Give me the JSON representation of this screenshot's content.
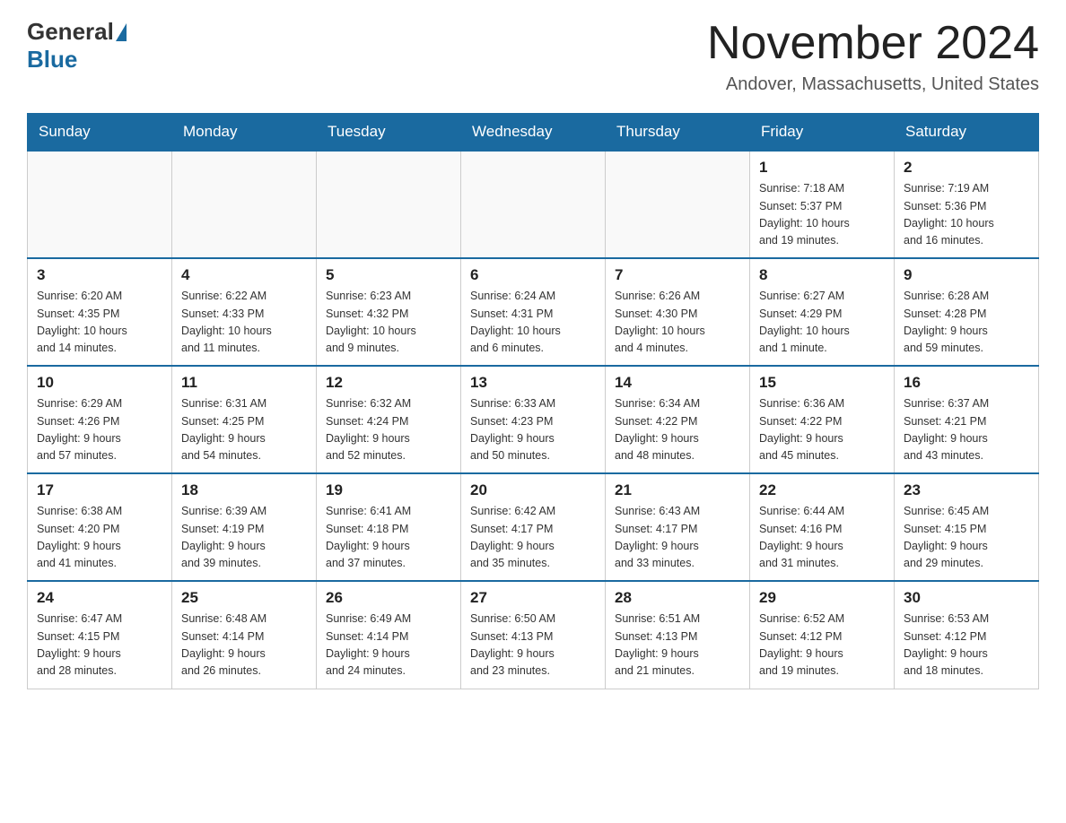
{
  "logo": {
    "general": "General",
    "blue": "Blue"
  },
  "title": "November 2024",
  "location": "Andover, Massachusetts, United States",
  "weekdays": [
    "Sunday",
    "Monday",
    "Tuesday",
    "Wednesday",
    "Thursday",
    "Friday",
    "Saturday"
  ],
  "weeks": [
    [
      {
        "day": "",
        "info": ""
      },
      {
        "day": "",
        "info": ""
      },
      {
        "day": "",
        "info": ""
      },
      {
        "day": "",
        "info": ""
      },
      {
        "day": "",
        "info": ""
      },
      {
        "day": "1",
        "info": "Sunrise: 7:18 AM\nSunset: 5:37 PM\nDaylight: 10 hours\nand 19 minutes."
      },
      {
        "day": "2",
        "info": "Sunrise: 7:19 AM\nSunset: 5:36 PM\nDaylight: 10 hours\nand 16 minutes."
      }
    ],
    [
      {
        "day": "3",
        "info": "Sunrise: 6:20 AM\nSunset: 4:35 PM\nDaylight: 10 hours\nand 14 minutes."
      },
      {
        "day": "4",
        "info": "Sunrise: 6:22 AM\nSunset: 4:33 PM\nDaylight: 10 hours\nand 11 minutes."
      },
      {
        "day": "5",
        "info": "Sunrise: 6:23 AM\nSunset: 4:32 PM\nDaylight: 10 hours\nand 9 minutes."
      },
      {
        "day": "6",
        "info": "Sunrise: 6:24 AM\nSunset: 4:31 PM\nDaylight: 10 hours\nand 6 minutes."
      },
      {
        "day": "7",
        "info": "Sunrise: 6:26 AM\nSunset: 4:30 PM\nDaylight: 10 hours\nand 4 minutes."
      },
      {
        "day": "8",
        "info": "Sunrise: 6:27 AM\nSunset: 4:29 PM\nDaylight: 10 hours\nand 1 minute."
      },
      {
        "day": "9",
        "info": "Sunrise: 6:28 AM\nSunset: 4:28 PM\nDaylight: 9 hours\nand 59 minutes."
      }
    ],
    [
      {
        "day": "10",
        "info": "Sunrise: 6:29 AM\nSunset: 4:26 PM\nDaylight: 9 hours\nand 57 minutes."
      },
      {
        "day": "11",
        "info": "Sunrise: 6:31 AM\nSunset: 4:25 PM\nDaylight: 9 hours\nand 54 minutes."
      },
      {
        "day": "12",
        "info": "Sunrise: 6:32 AM\nSunset: 4:24 PM\nDaylight: 9 hours\nand 52 minutes."
      },
      {
        "day": "13",
        "info": "Sunrise: 6:33 AM\nSunset: 4:23 PM\nDaylight: 9 hours\nand 50 minutes."
      },
      {
        "day": "14",
        "info": "Sunrise: 6:34 AM\nSunset: 4:22 PM\nDaylight: 9 hours\nand 48 minutes."
      },
      {
        "day": "15",
        "info": "Sunrise: 6:36 AM\nSunset: 4:22 PM\nDaylight: 9 hours\nand 45 minutes."
      },
      {
        "day": "16",
        "info": "Sunrise: 6:37 AM\nSunset: 4:21 PM\nDaylight: 9 hours\nand 43 minutes."
      }
    ],
    [
      {
        "day": "17",
        "info": "Sunrise: 6:38 AM\nSunset: 4:20 PM\nDaylight: 9 hours\nand 41 minutes."
      },
      {
        "day": "18",
        "info": "Sunrise: 6:39 AM\nSunset: 4:19 PM\nDaylight: 9 hours\nand 39 minutes."
      },
      {
        "day": "19",
        "info": "Sunrise: 6:41 AM\nSunset: 4:18 PM\nDaylight: 9 hours\nand 37 minutes."
      },
      {
        "day": "20",
        "info": "Sunrise: 6:42 AM\nSunset: 4:17 PM\nDaylight: 9 hours\nand 35 minutes."
      },
      {
        "day": "21",
        "info": "Sunrise: 6:43 AM\nSunset: 4:17 PM\nDaylight: 9 hours\nand 33 minutes."
      },
      {
        "day": "22",
        "info": "Sunrise: 6:44 AM\nSunset: 4:16 PM\nDaylight: 9 hours\nand 31 minutes."
      },
      {
        "day": "23",
        "info": "Sunrise: 6:45 AM\nSunset: 4:15 PM\nDaylight: 9 hours\nand 29 minutes."
      }
    ],
    [
      {
        "day": "24",
        "info": "Sunrise: 6:47 AM\nSunset: 4:15 PM\nDaylight: 9 hours\nand 28 minutes."
      },
      {
        "day": "25",
        "info": "Sunrise: 6:48 AM\nSunset: 4:14 PM\nDaylight: 9 hours\nand 26 minutes."
      },
      {
        "day": "26",
        "info": "Sunrise: 6:49 AM\nSunset: 4:14 PM\nDaylight: 9 hours\nand 24 minutes."
      },
      {
        "day": "27",
        "info": "Sunrise: 6:50 AM\nSunset: 4:13 PM\nDaylight: 9 hours\nand 23 minutes."
      },
      {
        "day": "28",
        "info": "Sunrise: 6:51 AM\nSunset: 4:13 PM\nDaylight: 9 hours\nand 21 minutes."
      },
      {
        "day": "29",
        "info": "Sunrise: 6:52 AM\nSunset: 4:12 PM\nDaylight: 9 hours\nand 19 minutes."
      },
      {
        "day": "30",
        "info": "Sunrise: 6:53 AM\nSunset: 4:12 PM\nDaylight: 9 hours\nand 18 minutes."
      }
    ]
  ]
}
